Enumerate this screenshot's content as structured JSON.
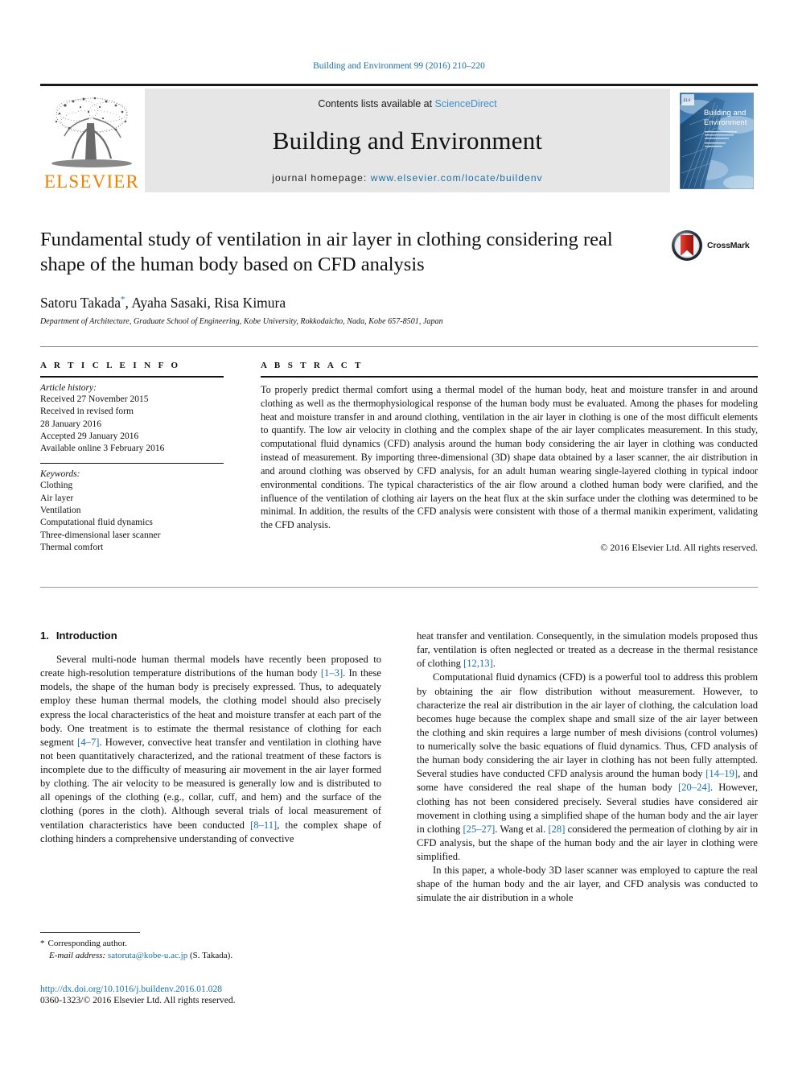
{
  "running_head": "Building and Environment 99 (2016) 210–220",
  "masthead": {
    "publisher_name": "ELSEVIER",
    "publisher_logo_icon": "elsevier-tree-icon",
    "contents_prefix": "Contents lists available at ",
    "contents_link": "ScienceDirect",
    "journal_name": "Building and Environment",
    "homepage_prefix": "journal homepage: ",
    "homepage_link": "www.elsevier.com/locate/buildenv",
    "cover_icon": "journal-cover-icon",
    "cover_title_line1": "Building and",
    "cover_title_line2": "Environment"
  },
  "article": {
    "title": "Fundamental study of ventilation in air layer in clothing considering real shape of the human body based on CFD analysis",
    "crossmark_label": "CrossMark",
    "crossmark_icon": "crossmark-icon",
    "authors": "Satoru Takada",
    "authors_rest": ", Ayaha Sasaki, Risa Kimura",
    "corresponding_marker": "*",
    "affiliation": "Department of Architecture, Graduate School of Engineering, Kobe University, Rokkodaicho, Nada, Kobe 657-8501, Japan"
  },
  "article_info": {
    "heading": "A R T I C L E  I N F O",
    "history_label": "Article history:",
    "history": [
      "Received 27 November 2015",
      "Received in revised form",
      "28 January 2016",
      "Accepted 29 January 2016",
      "Available online 3 February 2016"
    ],
    "keywords_label": "Keywords:",
    "keywords": [
      "Clothing",
      "Air layer",
      "Ventilation",
      "Computational fluid dynamics",
      "Three-dimensional laser scanner",
      "Thermal comfort"
    ]
  },
  "abstract": {
    "heading": "A B S T R A C T",
    "text": "To properly predict thermal comfort using a thermal model of the human body, heat and moisture transfer in and around clothing as well as the thermophysiological response of the human body must be evaluated. Among the phases for modeling heat and moisture transfer in and around clothing, ventilation in the air layer in clothing is one of the most difficult elements to quantify. The low air velocity in clothing and the complex shape of the air layer complicates measurement. In this study, computational fluid dynamics (CFD) analysis around the human body considering the air layer in clothing was conducted instead of measurement. By importing three-dimensional (3D) shape data obtained by a laser scanner, the air distribution in and around clothing was observed by CFD analysis, for an adult human wearing single-layered clothing in typical indoor environmental conditions. The typical characteristics of the air flow around a clothed human body were clarified, and the influence of the ventilation of clothing air layers on the heat flux at the skin surface under the clothing was determined to be minimal. In addition, the results of the CFD analysis were consistent with those of a thermal manikin experiment, validating the CFD analysis.",
    "copyright": "© 2016 Elsevier Ltd. All rights reserved."
  },
  "introduction": {
    "number": "1.",
    "title": "Introduction",
    "left_paragraph_1_a": "Several multi-node human thermal models have recently been proposed to create high-resolution temperature distributions of the human body ",
    "left_ref_1": "[1–3]",
    "left_paragraph_1_b": ". In these models, the shape of the human body is precisely expressed. Thus, to adequately employ these human thermal models, the clothing model should also precisely express the local characteristics of the heat and moisture transfer at each part of the body. One treatment is to estimate the thermal resistance of clothing for each segment ",
    "left_ref_2": "[4–7]",
    "left_paragraph_1_c": ". However, convective heat transfer and ventilation in clothing have not been quantitatively characterized, and the rational treatment of these factors is incomplete due to the difficulty of measuring air movement in the air layer formed by clothing. The air velocity to be measured is generally low and is distributed to all openings of the clothing (e.g., collar, cuff, and hem) and the surface of the clothing (pores in the cloth). Although several trials of local measurement of ventilation characteristics have been conducted ",
    "left_ref_3": "[8–11]",
    "left_paragraph_1_d": ", the complex shape of clothing hinders a comprehensive understanding of convective",
    "right_paragraph_1_a": "heat transfer and ventilation. Consequently, in the simulation models proposed thus far, ventilation is often neglected or treated as a decrease in the thermal resistance of clothing ",
    "right_ref_1": "[12,13]",
    "right_paragraph_1_b": ".",
    "right_paragraph_2_a": "Computational fluid dynamics (CFD) is a powerful tool to address this problem by obtaining the air flow distribution without measurement. However, to characterize the real air distribution in the air layer of clothing, the calculation load becomes huge because the complex shape and small size of the air layer between the clothing and skin requires a large number of mesh divisions (control volumes) to numerically solve the basic equations of fluid dynamics. Thus, CFD analysis of the human body considering the air layer in clothing has not been fully attempted. Several studies have conducted CFD analysis around the human body ",
    "right_ref_2": "[14–19]",
    "right_paragraph_2_b": ", and some have considered the real shape of the human body ",
    "right_ref_3": "[20–24]",
    "right_paragraph_2_c": ". However, clothing has not been considered precisely. Several studies have considered air movement in clothing using a simplified shape of the human body and the air layer in clothing ",
    "right_ref_4": "[25–27]",
    "right_paragraph_2_d": ". Wang et al. ",
    "right_ref_5": "[28]",
    "right_paragraph_2_e": " considered the permeation of clothing by air in CFD analysis, but the shape of the human body and the air layer in clothing were simplified.",
    "right_paragraph_3": "In this paper, a whole-body 3D laser scanner was employed to capture the real shape of the human body and the air layer, and CFD analysis was conducted to simulate the air distribution in a whole"
  },
  "footnote": {
    "corresponding_star": "*",
    "corresponding_text": "Corresponding author.",
    "email_label": "E-mail address:",
    "email": "satoruta@kobe-u.ac.jp",
    "email_suffix": "(S. Takada)."
  },
  "footer": {
    "doi": "http://dx.doi.org/10.1016/j.buildenv.2016.01.028",
    "issn_line": "0360-1323/© 2016 Elsevier Ltd. All rights reserved."
  },
  "colors": {
    "link_blue": "#1a6fa8",
    "sciencedirect_blue": "#3d8ec9",
    "elsevier_orange": "#f08000",
    "masthead_gray": "#e6e6e6"
  }
}
